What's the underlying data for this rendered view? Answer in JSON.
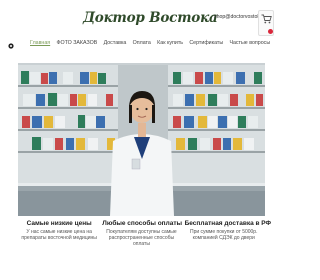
{
  "header": {
    "logo_text": "Доктор Востока",
    "email": "shop@doctorvostoka"
  },
  "nav": {
    "items": [
      {
        "label": "Главная",
        "active": true
      },
      {
        "label": "ФОТО ЗАКАЗОВ",
        "active": false
      },
      {
        "label": "Доставка",
        "active": false
      },
      {
        "label": "Оплата",
        "active": false
      },
      {
        "label": "Как купить",
        "active": false
      },
      {
        "label": "Сертификаты",
        "active": false
      },
      {
        "label": "Частые вопросы",
        "active": false
      }
    ]
  },
  "features": [
    {
      "title": "Самые низкие цены",
      "desc": "У нас самые низкие цена на препараты восточной медицины"
    },
    {
      "title": "Любые способы оплаты",
      "desc": "Покупателям доступны самые распространенные способы оплаты"
    },
    {
      "title": "Бесплатная доставка в РФ",
      "desc": "При сумме покупки от 5000р. компанией СДЭК до двери"
    }
  ],
  "colors": {
    "accent": "#7a9a56",
    "logo": "#2f4a2a",
    "badge": "#d9263a"
  }
}
